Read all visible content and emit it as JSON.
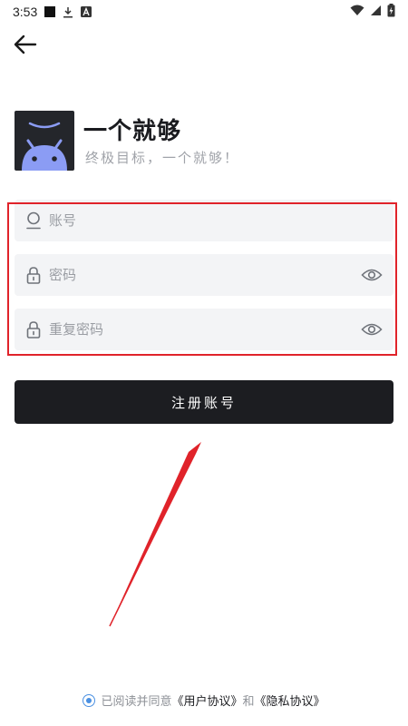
{
  "status_bar": {
    "time": "3:53",
    "icons": [
      "notification-square-icon",
      "download-icon",
      "a-badge-icon",
      "wifi-icon",
      "cell-signal-icon",
      "battery-charging-icon"
    ]
  },
  "header": {
    "back_icon": "arrow-left-icon"
  },
  "brand": {
    "title": "一个就够",
    "subtitle": "终极目标，一个就够！"
  },
  "form": {
    "account_placeholder": "账号",
    "password_placeholder": "密码",
    "repeat_password_placeholder": "重复密码",
    "highlight_color": "#e0232a"
  },
  "register_button": {
    "label": "注册账号"
  },
  "agreement": {
    "prefix": "已阅读并同意",
    "user_agreement": "《用户协议》",
    "conjunction": "和",
    "privacy_agreement": "《隐私协议》",
    "checked": true
  },
  "colors": {
    "primary_dark": "#1c1d21",
    "accent_blue": "#4a90e2",
    "annotation_red": "#e0232a",
    "field_bg": "#f3f4f6"
  }
}
